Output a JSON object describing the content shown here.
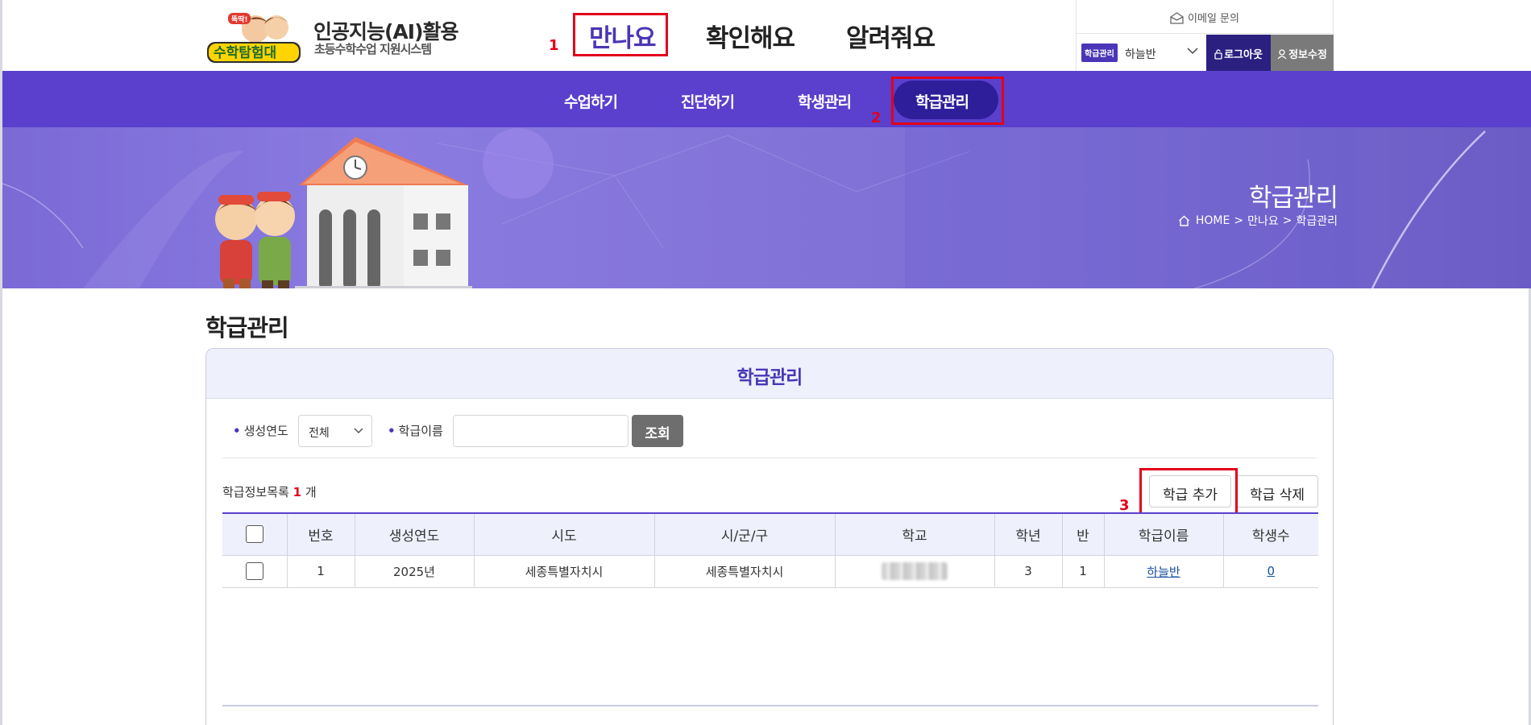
{
  "header": {
    "site_title": "인공지능(AI)활용",
    "site_subtitle": "초등수학수업 지원시스템",
    "gnb": [
      {
        "label": "만나요"
      },
      {
        "label": "확인해요"
      },
      {
        "label": "알려줘요"
      }
    ],
    "util": {
      "email_label": "이메일 문의",
      "class_tag": "학급관리",
      "class_name": "하늘반",
      "logout_label": "로그아웃",
      "profile_label": "정보수정"
    }
  },
  "subnav": {
    "items": [
      {
        "label": "수업하기"
      },
      {
        "label": "진단하기"
      },
      {
        "label": "학생관리"
      },
      {
        "label": "학급관리"
      }
    ]
  },
  "banner": {
    "title": "학급관리",
    "breadcrumb": [
      "HOME",
      ">",
      "만나요",
      ">",
      "학급관리"
    ]
  },
  "annotations": [
    "1",
    "2",
    "3"
  ],
  "main": {
    "page_title": "학급관리",
    "panel_title": "학급관리",
    "filters": {
      "year_label": "생성연도",
      "year_value": "전체",
      "class_name_label": "학급이름",
      "class_name_value": "",
      "search_label": "조회"
    },
    "list": {
      "count_prefix": "학급정보목록",
      "count": "1",
      "count_suffix": "개",
      "add_label": "학급 추가",
      "delete_label": "학급 삭제"
    },
    "table": {
      "headers": [
        "번호",
        "생성연도",
        "시도",
        "시/군/구",
        "학교",
        "학년",
        "반",
        "학급이름",
        "학생수"
      ],
      "rows": [
        {
          "no": "1",
          "year": "2025년",
          "province": "세종특별자치시",
          "city": "세종특별자치시",
          "grade": "3",
          "class": "1",
          "class_name": "하늘반",
          "students": "0"
        }
      ]
    }
  },
  "colors": {
    "brand": "#5a40cd",
    "brand_dark": "#2f1e9a",
    "annotation": "#e3001b"
  }
}
